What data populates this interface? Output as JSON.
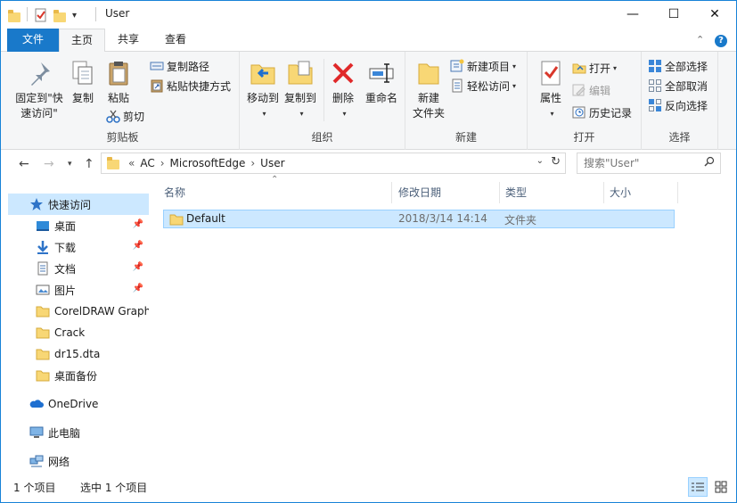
{
  "window": {
    "title": "User",
    "minimize_glyph": "—",
    "maximize_glyph": "☐",
    "close_glyph": "✕"
  },
  "ribbon_tabs": {
    "file": "文件",
    "home": "主页",
    "share": "共享",
    "view": "查看"
  },
  "ribbon": {
    "clipboard": {
      "label": "剪贴板",
      "pin_quick_access_line1": "固定到\"快",
      "pin_quick_access_line2": "速访问\"",
      "copy": "复制",
      "paste": "粘贴",
      "copy_path": "复制路径",
      "paste_shortcut": "粘贴快捷方式",
      "cut": "剪切"
    },
    "organize": {
      "label": "组织",
      "move_to": "移动到",
      "copy_to": "复制到",
      "delete": "删除",
      "rename": "重命名"
    },
    "new": {
      "label": "新建",
      "new_folder_line1": "新建",
      "new_folder_line2": "文件夹",
      "new_item": "新建项目",
      "easy_access": "轻松访问"
    },
    "open": {
      "label": "打开",
      "properties": "属性",
      "open": "打开",
      "edit": "编辑",
      "history": "历史记录"
    },
    "select": {
      "label": "选择",
      "select_all": "全部选择",
      "select_none": "全部取消",
      "invert": "反向选择"
    }
  },
  "address_bar": {
    "prefix": "«",
    "crumbs": [
      "AC",
      "MicrosoftEdge",
      "User"
    ],
    "search_placeholder": "搜索\"User\""
  },
  "nav_pane": {
    "quick_access": "快速访问",
    "items": [
      {
        "label": "桌面",
        "pinned": true
      },
      {
        "label": "下载",
        "pinned": true
      },
      {
        "label": "文档",
        "pinned": true
      },
      {
        "label": "图片",
        "pinned": true
      },
      {
        "label": "CorelDRAW Graphics",
        "pinned": false
      },
      {
        "label": "Crack",
        "pinned": false
      },
      {
        "label": "dr15.dta",
        "pinned": false
      },
      {
        "label": "桌面备份",
        "pinned": false
      }
    ],
    "onedrive": "OneDrive",
    "this_pc": "此电脑",
    "network": "网络"
  },
  "file_list": {
    "columns": [
      "名称",
      "修改日期",
      "类型",
      "大小"
    ],
    "rows": [
      {
        "name": "Default",
        "modified": "2018/3/14 14:14",
        "type": "文件夹",
        "size": ""
      }
    ]
  },
  "status_bar": {
    "item_count": "1 个项目",
    "selected": "选中 1 个项目"
  },
  "colors": {
    "accent": "#1979ca",
    "selection": "#cce8ff",
    "selection_border": "#99d1ff",
    "folder": "#f8d775",
    "delete_red": "#e0292a"
  }
}
